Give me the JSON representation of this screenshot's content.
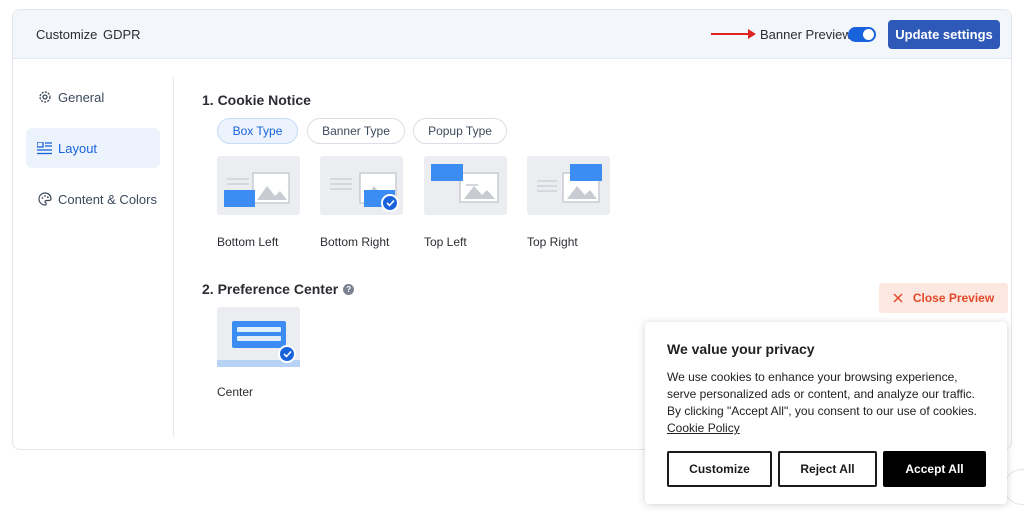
{
  "header": {
    "breadcrumb": [
      "Customize",
      "GDPR"
    ],
    "banner_preview_label": "Banner Preview",
    "banner_preview_on": true,
    "update_button": "Update settings"
  },
  "sidebar": {
    "items": [
      {
        "label": "General",
        "icon": "gear-icon",
        "active": false
      },
      {
        "label": "Layout",
        "icon": "layout-icon",
        "active": true
      },
      {
        "label": "Content & Colors",
        "icon": "palette-icon",
        "active": false
      }
    ]
  },
  "main": {
    "cookie_notice": {
      "title": "1. Cookie Notice",
      "tabs": [
        "Box Type",
        "Banner Type",
        "Popup Type"
      ],
      "active_tab": "Box Type",
      "options": [
        "Bottom Left",
        "Bottom Right",
        "Top Left",
        "Top Right"
      ],
      "selected": "Bottom Right"
    },
    "preference_center": {
      "title": "2. Preference Center",
      "options": [
        "Center"
      ],
      "selected": "Center"
    }
  },
  "close_preview": "Close Preview",
  "banner": {
    "title": "We value your privacy",
    "description": "We use cookies to enhance your browsing experience, serve personalized ads or content, and analyze our traffic. By clicking \"Accept All\", you consent to our use of cookies.",
    "policy_link": "Cookie Policy",
    "buttons": {
      "customize": "Customize",
      "reject": "Reject All",
      "accept": "Accept All"
    }
  },
  "colors": {
    "accent": "#1863dc",
    "update_button": "#2f59b8",
    "close_preview_text": "#e0492a",
    "thumb_blue": "#3b8df3"
  }
}
